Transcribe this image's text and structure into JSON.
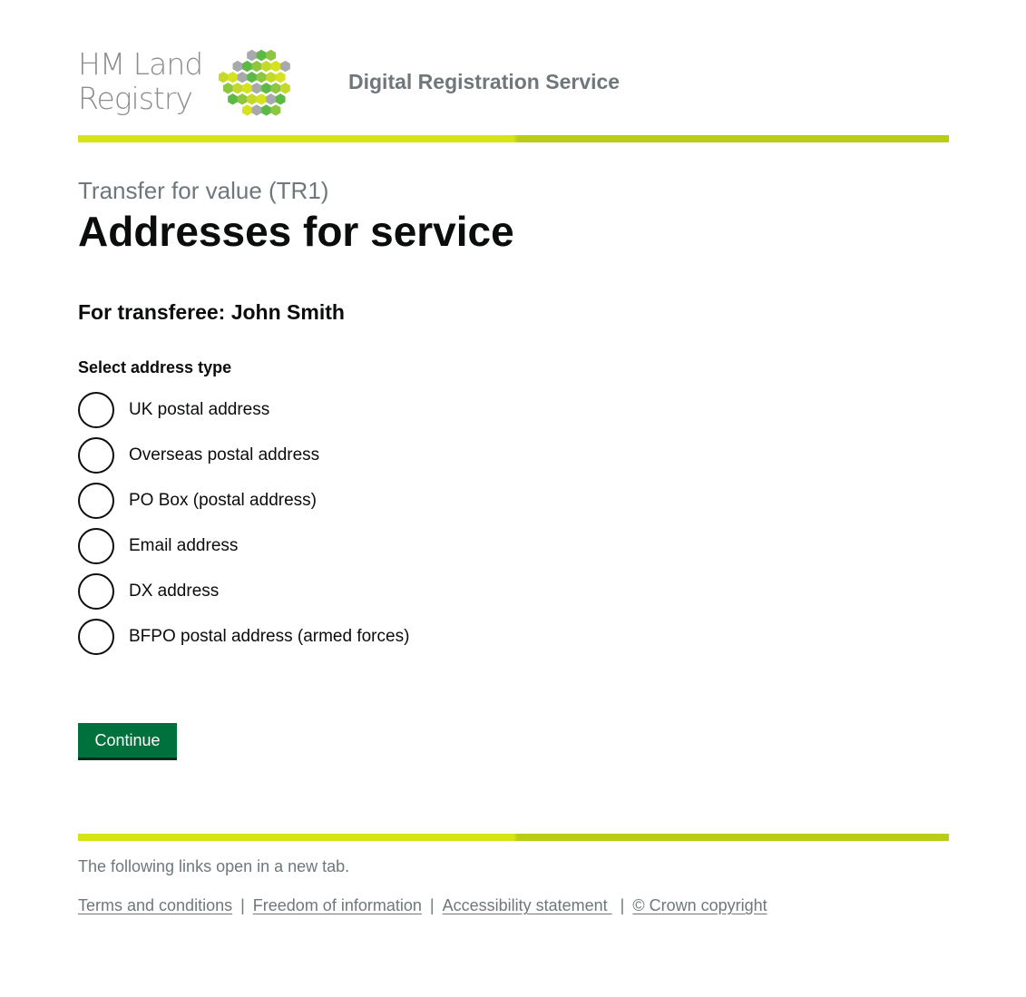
{
  "header": {
    "logo_line1": "HM Land",
    "logo_line2": "Registry",
    "service_name": "Digital Registration Service"
  },
  "main": {
    "caption": "Transfer for value (TR1)",
    "title": "Addresses for service",
    "subheading": "For transferee: John Smith",
    "legend": "Select address type",
    "options": [
      {
        "label": "UK postal address"
      },
      {
        "label": "Overseas postal address"
      },
      {
        "label": "PO Box (postal address)"
      },
      {
        "label": "Email address"
      },
      {
        "label": "DX address"
      },
      {
        "label": "BFPO postal address (armed forces)"
      }
    ],
    "continue_label": "Continue"
  },
  "footer": {
    "note": "The following links open in a new tab.",
    "links": [
      {
        "label": "Terms and conditions"
      },
      {
        "label": "Freedom of information"
      },
      {
        "label": "Accessibility statement "
      },
      {
        "label": "© Crown copyright"
      }
    ],
    "separator": "|"
  },
  "colors": {
    "brand_green": "#00703c",
    "rule_light": "#d6e314",
    "rule_dark": "#b9cc17",
    "muted_text": "#6f777b"
  }
}
